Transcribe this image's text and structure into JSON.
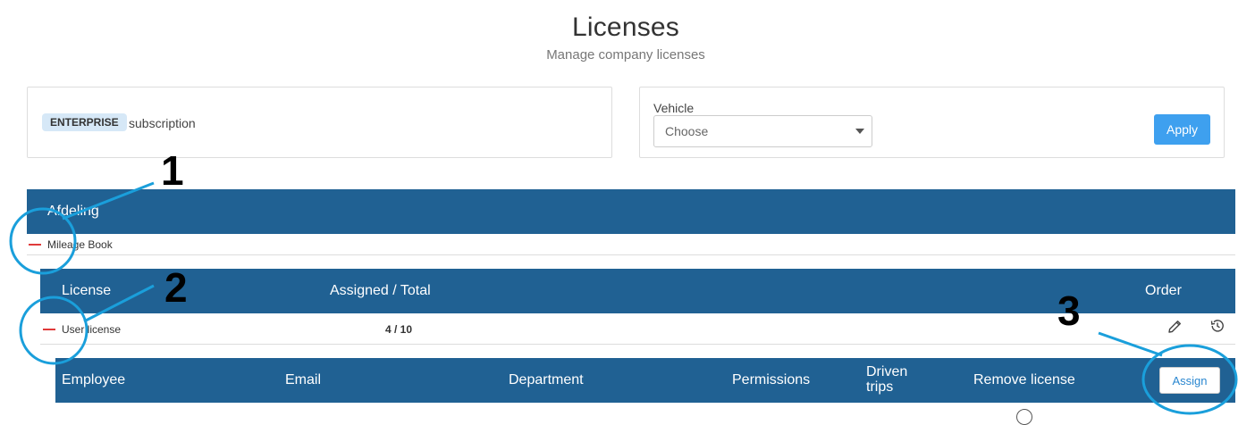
{
  "header": {
    "title": "Licenses",
    "subtitle": "Manage company licenses"
  },
  "subscription": {
    "badge": "ENTERPRISE",
    "text": "subscription"
  },
  "vehicle": {
    "label": "Vehicle",
    "selected": "Choose",
    "apply_label": "Apply"
  },
  "afdeling": {
    "header": "Afdeling",
    "rows": [
      "Mileage Book"
    ]
  },
  "license_table": {
    "headers": {
      "license": "License",
      "assigned_total": "Assigned / Total",
      "order": "Order"
    },
    "rows": [
      {
        "name": "User license",
        "assigned": "4 / 10"
      }
    ]
  },
  "employee_table": {
    "headers": {
      "employee": "Employee",
      "email": "Email",
      "department": "Department",
      "permissions": "Permissions",
      "driven_trips_line1": "Driven",
      "driven_trips_line2": "trips",
      "remove_license": "Remove license"
    },
    "assign_label": "Assign"
  },
  "annotations": [
    "1",
    "2",
    "3"
  ],
  "colors": {
    "header_band": "#206193",
    "apply_button": "#3ea0ef",
    "annotation": "#1a9fdb",
    "collapse_dash": "#e03a3a"
  }
}
